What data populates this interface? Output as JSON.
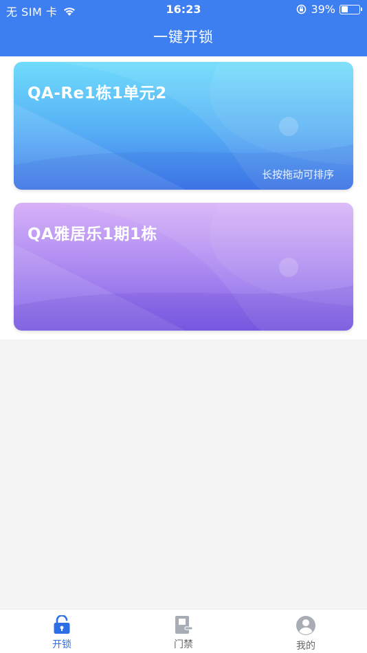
{
  "status_bar": {
    "carrier": "无 SIM 卡",
    "time": "16:23",
    "battery_pct": "39%",
    "battery_level": 0.39
  },
  "header": {
    "title": "一键开锁"
  },
  "cards": [
    {
      "name": "QA-Re1栋1单元2",
      "hint": "长按拖动可排序",
      "color": "#56aef5"
    },
    {
      "name": "QA雅居乐1期1栋",
      "color": "#a886f0"
    }
  ],
  "tabbar": {
    "items": [
      {
        "label": "开锁",
        "icon": "lock-open-icon",
        "active": true
      },
      {
        "label": "门禁",
        "icon": "door-access-icon",
        "active": false
      },
      {
        "label": "我的",
        "icon": "user-icon",
        "active": false
      }
    ],
    "active_color": "#2f6fe6",
    "inactive_color": "#8a8f99"
  }
}
